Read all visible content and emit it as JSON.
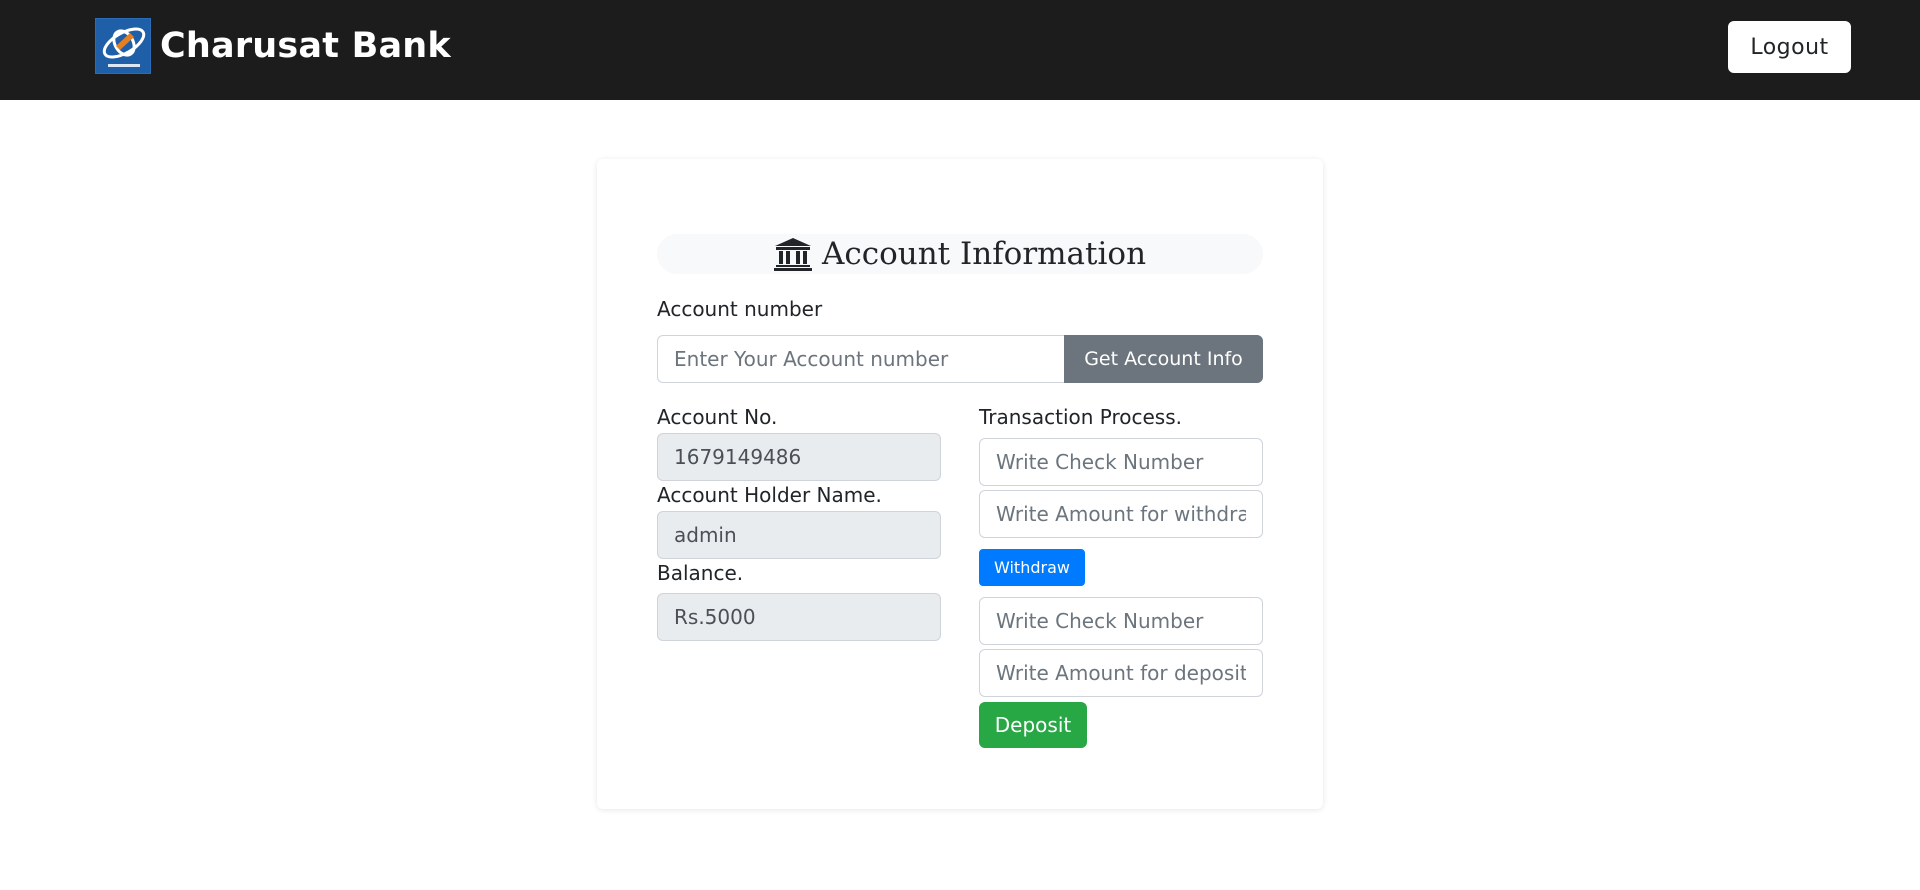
{
  "navbar": {
    "brand_name": "Charusat Bank",
    "logout_label": "Logout",
    "logo_icon": "bank-logo-icon"
  },
  "card": {
    "title": "Account Information",
    "title_icon": "bank-building-icon",
    "account_number_label": "Account number",
    "account_number_placeholder": "Enter Your Account number",
    "get_info_label": "Get Account Info",
    "account_no_label": "Account No.",
    "account_no_value": "1679149486",
    "holder_name_label": "Account Holder Name.",
    "holder_name_value": "admin",
    "balance_label": "Balance.",
    "balance_value": "Rs.5000",
    "transaction_label": "Transaction Process.",
    "withdraw_check_placeholder": "Write Check Number",
    "withdraw_amount_placeholder": "Write Amount for withdraw",
    "withdraw_label": "Withdraw",
    "deposit_check_placeholder": "Write Check Number",
    "deposit_amount_placeholder": "Write Amount for deposit",
    "deposit_label": "Deposit"
  },
  "colors": {
    "navbar_bg": "#1c1c1c",
    "secondary": "#6c757d",
    "primary": "#007bff",
    "success": "#28a745",
    "readonly_bg": "#e9ecef"
  }
}
